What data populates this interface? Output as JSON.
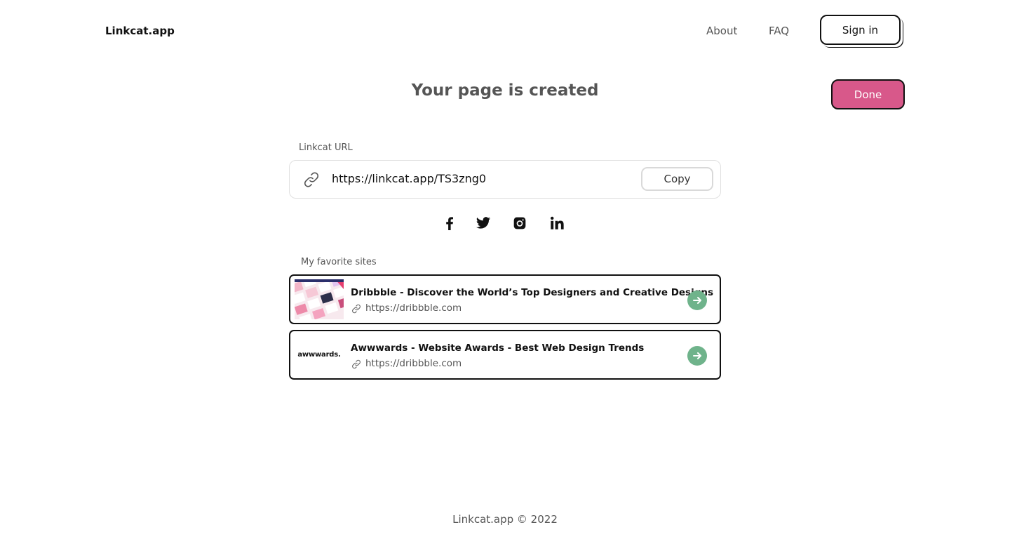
{
  "header": {
    "logo": "Linkcat.app",
    "nav": [
      {
        "label": "About"
      },
      {
        "label": "FAQ"
      }
    ],
    "signin_label": "Sign in"
  },
  "main": {
    "title": "Your page is created",
    "done_label": "Done",
    "url_label": "Linkcat URL",
    "url_value": "https://linkcat.app/TS3zng0",
    "copy_label": "Copy",
    "social_icons": [
      "facebook-icon",
      "twitter-icon",
      "instagram-icon",
      "linkedin-icon"
    ],
    "favorites_label": "My favorite sites",
    "favorites": [
      {
        "title": "Dribbble - Discover the World’s Top Designers and Creative Designs",
        "url": "https://dribbble.com"
      },
      {
        "title": "Awwwards - Website Awards - Best Web Design Trends",
        "url": "https://dribbble.com",
        "logo_text": "awwwards."
      }
    ]
  },
  "footer": {
    "text": "Linkcat.app © 2022"
  },
  "colors": {
    "accent": "#d8588a",
    "go_button": "#6fb38b",
    "text_muted": "#555555"
  }
}
